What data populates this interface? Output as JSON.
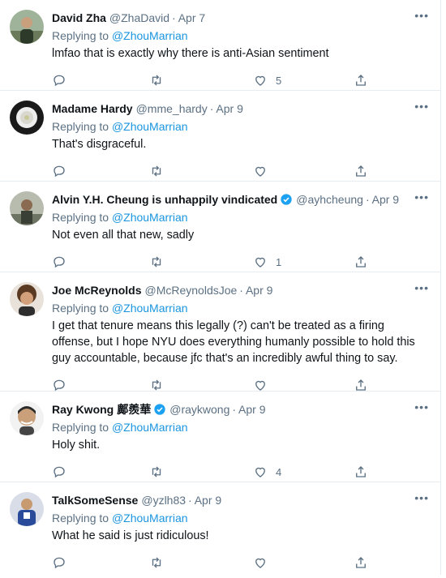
{
  "tweets": [
    {
      "name": "David Zha",
      "name_extra": "",
      "verified": false,
      "handle": "@ZhaDavid",
      "date": "Apr 7",
      "reply_prefix": "Replying to ",
      "reply_mention": "@ZhouMarrian",
      "text": "lmfao that is exactly why there is anti-Asian sentiment",
      "likes": "5",
      "avatar_color": "#6a7a5a"
    },
    {
      "name": "Madame Hardy",
      "name_extra": "",
      "verified": false,
      "handle": "@mme_hardy",
      "date": "Apr 9",
      "reply_prefix": "Replying to ",
      "reply_mention": "@ZhouMarrian",
      "text": "That's disgraceful.",
      "likes": "",
      "avatar_color": "#1a1a1a"
    },
    {
      "name": "Alvin Y.H. Cheung is unhappily vindicated",
      "name_extra": "",
      "verified": true,
      "handle": "@ayhcheung",
      "date": "Apr 9",
      "reply_prefix": "Replying to ",
      "reply_mention": "@ZhouMarrian",
      "text": "Not even all that new, sadly",
      "likes": "1",
      "avatar_color": "#8a8f84"
    },
    {
      "name": "Joe McReynolds",
      "name_extra": "",
      "verified": false,
      "handle": "@McReynoldsJoe",
      "date": "Apr 9",
      "reply_prefix": "Replying to ",
      "reply_mention": "@ZhouMarrian",
      "text": "I get that tenure means this legally (?) can't be treated as a firing offense, but I hope NYU does everything humanly possible to hold this guy accountable, because jfc that's an incredibly awful thing to say.",
      "likes": "",
      "avatar_color": "#7a5a40"
    },
    {
      "name": "Ray Kwong",
      "name_extra": "鄺羨華",
      "verified": true,
      "handle": "@raykwong",
      "date": "Apr 9",
      "reply_prefix": "Replying to ",
      "reply_mention": "@ZhouMarrian",
      "text": "Holy shit.",
      "likes": "4",
      "avatar_color": "#c9a07a"
    },
    {
      "name": "TalkSomeSense",
      "name_extra": "",
      "verified": false,
      "handle": "@yzlh83",
      "date": "Apr 9",
      "reply_prefix": "Replying to ",
      "reply_mention": "@ZhouMarrian",
      "text": "What he said is just ridiculous!",
      "likes": "",
      "avatar_color": "#2a4a9a"
    }
  ],
  "dot_separator": "·",
  "more_glyph": "•••",
  "colors": {
    "accent": "#1b95e0",
    "muted": "#5b7083",
    "text": "#0f1419",
    "verified": "#1da1f2"
  },
  "icons": [
    "reply-icon",
    "retweet-icon",
    "like-icon",
    "share-icon",
    "more-icon",
    "verified-badge-icon"
  ]
}
